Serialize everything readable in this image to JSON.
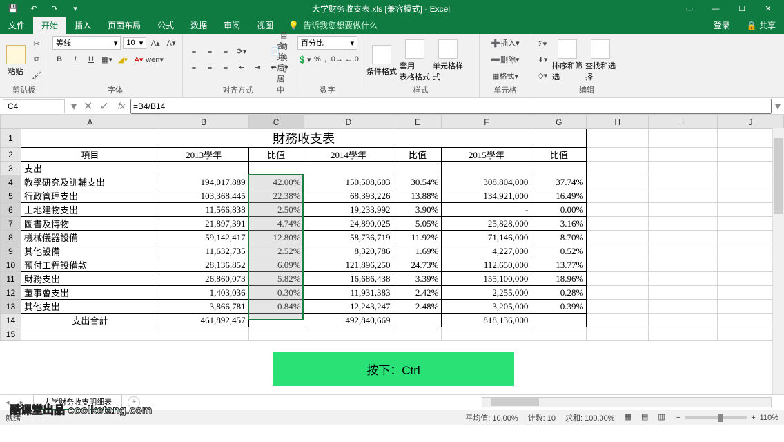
{
  "app": {
    "title": "大学财务收支表.xls  [兼容模式] - Excel"
  },
  "tabs": {
    "file": "文件",
    "home": "开始",
    "insert": "插入",
    "layout": "页面布局",
    "formulas": "公式",
    "data": "数据",
    "review": "审阅",
    "view": "视图",
    "tellme": "告诉我您想要做什么",
    "login": "登录",
    "share": "共享"
  },
  "ribbon": {
    "clipboard": {
      "label": "剪贴板",
      "paste": "粘贴"
    },
    "font": {
      "label": "字体",
      "name": "等线",
      "size": "10",
      "b": "B",
      "i": "I",
      "u": "U"
    },
    "align": {
      "label": "对齐方式",
      "wrap": "自动换行",
      "merge": "合并后居中"
    },
    "number": {
      "label": "数字",
      "fmt": "百分比"
    },
    "styles": {
      "label": "样式",
      "cf": "条件格式",
      "tb": "套用\n表格格式",
      "cs": "单元格样式"
    },
    "cells": {
      "label": "单元格",
      "ins": "插入",
      "del": "删除",
      "fmt": "格式"
    },
    "editing": {
      "label": "编辑",
      "sort": "排序和筛选",
      "find": "查找和选择"
    }
  },
  "namebox": {
    "ref": "C4",
    "formula": "=B4/B14"
  },
  "cols": [
    "A",
    "B",
    "C",
    "D",
    "E",
    "F",
    "G",
    "H",
    "I",
    "J"
  ],
  "sheet": {
    "title": "財務收支表",
    "headers": [
      "項目",
      "2013學年",
      "比值",
      "2014學年",
      "比值",
      "2015學年",
      "比值"
    ],
    "section": "支出",
    "rows": [
      {
        "a": "教學研究及訓輔支出",
        "b": "194,017,889",
        "c": "42.00%",
        "d": "150,508,603",
        "e": "30.54%",
        "f": "308,804,000",
        "g": "37.74%"
      },
      {
        "a": "行政管理支出",
        "b": "103,368,445",
        "c": "22.38%",
        "d": "68,393,226",
        "e": "13.88%",
        "f": "134,921,000",
        "g": "16.49%"
      },
      {
        "a": "土地建物支出",
        "b": "11,566,838",
        "c": "2.50%",
        "d": "19,233,992",
        "e": "3.90%",
        "f": "-",
        "g": "0.00%"
      },
      {
        "a": "圖書及博物",
        "b": "21,897,391",
        "c": "4.74%",
        "d": "24,890,025",
        "e": "5.05%",
        "f": "25,828,000",
        "g": "3.16%"
      },
      {
        "a": "機械儀器設備",
        "b": "59,142,417",
        "c": "12.80%",
        "d": "58,736,719",
        "e": "11.92%",
        "f": "71,146,000",
        "g": "8.70%"
      },
      {
        "a": "其他設備",
        "b": "11,632,735",
        "c": "2.52%",
        "d": "8,320,786",
        "e": "1.69%",
        "f": "4,227,000",
        "g": "0.52%"
      },
      {
        "a": "預付工程設備款",
        "b": "28,136,852",
        "c": "6.09%",
        "d": "121,896,250",
        "e": "24.73%",
        "f": "112,650,000",
        "g": "13.77%"
      },
      {
        "a": "財務支出",
        "b": "26,860,073",
        "c": "5.82%",
        "d": "16,686,438",
        "e": "3.39%",
        "f": "155,100,000",
        "g": "18.96%"
      },
      {
        "a": "董事會支出",
        "b": "1,403,036",
        "c": "0.30%",
        "d": "11,931,383",
        "e": "2.42%",
        "f": "2,255,000",
        "g": "0.28%"
      },
      {
        "a": "其他支出",
        "b": "3,866,781",
        "c": "0.84%",
        "d": "12,243,247",
        "e": "2.48%",
        "f": "3,205,000",
        "g": "0.39%"
      }
    ],
    "total": {
      "a": "支出合計",
      "b": "461,892,457",
      "c": "",
      "d": "492,840,669",
      "e": "",
      "f": "818,136,000",
      "g": ""
    },
    "tab": "大学财务收支明细表"
  },
  "status": {
    "ready": "就绪",
    "avg": "平均值: 10.00%",
    "cnt": "计数: 10",
    "sum": "求和: 100.00%",
    "zoom": "110%"
  },
  "overlay": {
    "ctrl": "按下：Ctrl"
  },
  "watermark": "酷课堂出品 coolketang.com"
}
